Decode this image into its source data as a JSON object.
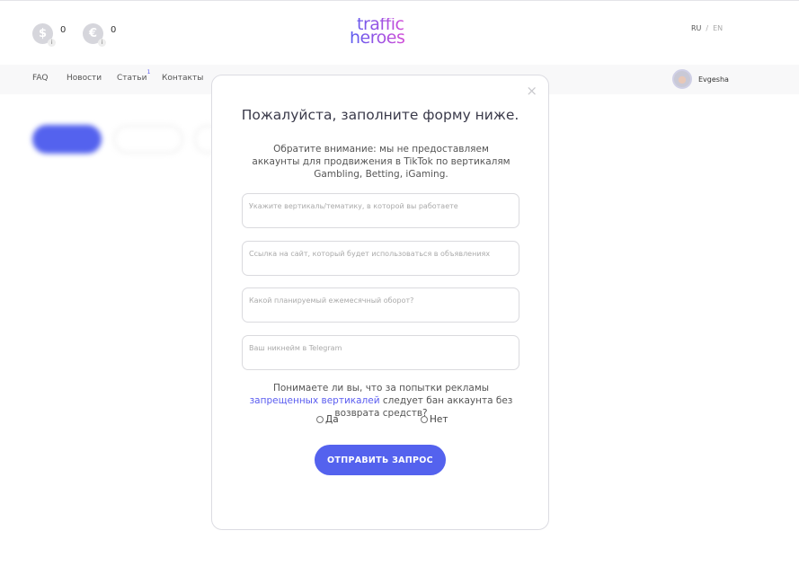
{
  "header": {
    "balances": [
      {
        "icon": "dollar-icon",
        "symbol": "$",
        "value": "0"
      },
      {
        "icon": "euro-icon",
        "symbol": "€",
        "value": "0"
      }
    ],
    "logo": {
      "line1": "traffic",
      "line2": "heroes"
    },
    "lang": {
      "ru": "RU",
      "sep": "/",
      "en": "EN"
    }
  },
  "nav": {
    "items": [
      {
        "label": "FAQ"
      },
      {
        "label": "Новости"
      },
      {
        "label": "Статьи",
        "badge": "1"
      },
      {
        "label": "Контакты"
      }
    ],
    "user": "Evgesha"
  },
  "modal": {
    "title": "Пожалуйста, заполните форму ниже.",
    "note": "Обратите внимание: мы не предоставляем аккаунты для продвижения в TikTok по вертикалям Gambling, Betting, iGaming.",
    "fields": [
      {
        "placeholder": "Укажите вертикаль/тематику, в которой вы работаете"
      },
      {
        "placeholder": "Ссылка на сайт, который будет использоваться в объявлениях"
      },
      {
        "placeholder": "Какой планируемый ежемесячный оборот?"
      },
      {
        "placeholder": "Ваш никнейм в Telegram"
      }
    ],
    "question": {
      "before": "Понимаете ли вы, что за попытки рекламы ",
      "link": "запрещенных вертикалей",
      "after": " следует бан аккаунта без возврата средств?"
    },
    "options": [
      "Да",
      "Нет"
    ],
    "submit": "ОТПРАВИТЬ ЗАПРОС",
    "close": "×"
  },
  "colors": {
    "accent": "#5462ee",
    "link": "#5a5cf0"
  }
}
